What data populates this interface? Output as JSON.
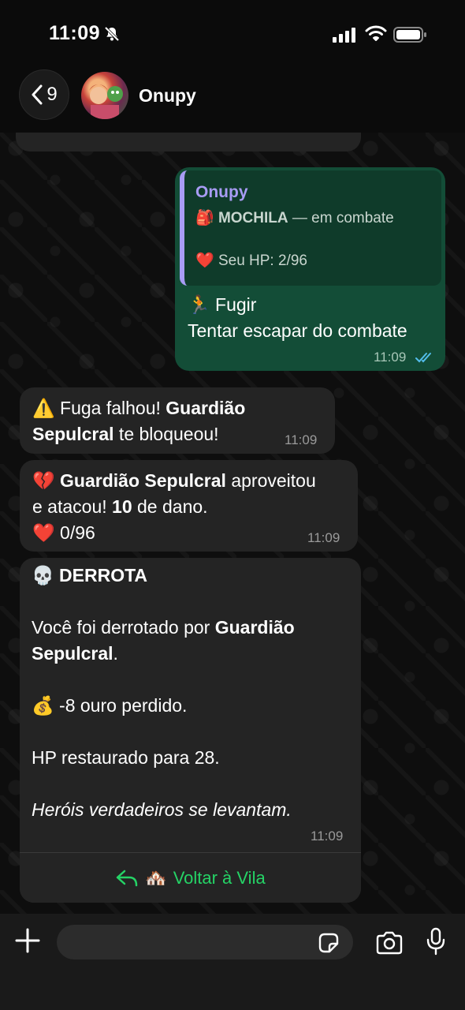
{
  "status_bar": {
    "time": "11:09"
  },
  "header": {
    "back_count": "9",
    "contact_name": "Onupy"
  },
  "messages": {
    "out": {
      "quote_author": "Onupy",
      "quote_line1_emoji": "🎒",
      "quote_line1_bold": "MOCHILA",
      "quote_line1_rest": " — em combate",
      "quote_line2_emoji": "❤️",
      "quote_line2_text": "Seu HP: 2/96",
      "action_emoji": "🏃",
      "action_title": "Fugir",
      "action_desc": "Tentar escapar do combate",
      "time": "11:09"
    },
    "m1": {
      "emoji": "⚠️",
      "text1": " Fuga falhou! ",
      "bold1": "Guardião",
      "bold2": "Sepulcral",
      "text2": " te bloqueou!",
      "time": "11:09"
    },
    "m2": {
      "emoji": "💔",
      "bold1": "Guardião Sepulcral",
      "text1": " aproveitou",
      "text2": "e atacou! ",
      "bold2": "10",
      "text3": " de dano.",
      "hp_emoji": "❤️",
      "hp_text": " 0/96",
      "time": "11:09"
    },
    "m3": {
      "title_emoji": "💀",
      "title": "DERROTA",
      "line1_text": "Você foi derrotado por ",
      "line1_bold": "Guardião",
      "line2_bold": "Sepulcral",
      "line2_text": ".",
      "gold_emoji": "💰",
      "gold_text": " -8 ouro perdido.",
      "hp_text": "HP restaurado para 28.",
      "italic_text": "Heróis verdadeiros se levantam.",
      "time": "11:09",
      "reply_emoji": "🏘️",
      "reply_label": "Voltar à Vila"
    }
  },
  "colors": {
    "accent_green": "#25d366",
    "outgoing_bubble": "#134d37",
    "incoming_bubble": "#242424",
    "quote_author": "#a89cf5"
  }
}
